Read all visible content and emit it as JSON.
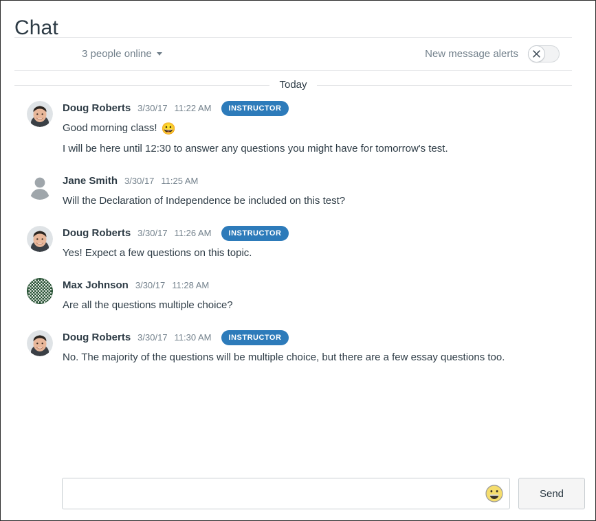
{
  "header": {
    "title": "Chat"
  },
  "toolbar": {
    "people_online_label": "3 people online",
    "alerts_label": "New message alerts",
    "alerts_toggle_state": "off",
    "alerts_toggle_icon": "close-x-icon"
  },
  "day_divider": {
    "label": "Today"
  },
  "messages": [
    {
      "author": "Doug Roberts",
      "date": "3/30/17",
      "time": "11:22 AM",
      "badge": "INSTRUCTOR",
      "avatar_type": "photo-man",
      "lines": [
        "Good morning class!",
        "I will be here until 12:30 to answer any questions you might have for tomorrow's test."
      ],
      "emoji": "😀"
    },
    {
      "author": "Jane Smith",
      "date": "3/30/17",
      "time": "11:25 AM",
      "badge": "",
      "avatar_type": "default-silhouette",
      "lines": [
        "Will the Declaration of Independence be included on this test?"
      ],
      "emoji": ""
    },
    {
      "author": "Doug Roberts",
      "date": "3/30/17",
      "time": "11:26 AM",
      "badge": "INSTRUCTOR",
      "avatar_type": "photo-man",
      "lines": [
        "Yes! Expect a few questions on this topic."
      ],
      "emoji": ""
    },
    {
      "author": "Max Johnson",
      "date": "3/30/17",
      "time": "11:28 AM",
      "badge": "",
      "avatar_type": "identicon-green",
      "lines": [
        "Are all the questions multiple choice?"
      ],
      "emoji": ""
    },
    {
      "author": "Doug Roberts",
      "date": "3/30/17",
      "time": "11:30 AM",
      "badge": "INSTRUCTOR",
      "avatar_type": "photo-man",
      "lines": [
        "No. The majority of the questions will be multiple choice, but there are a few essay questions too."
      ],
      "emoji": ""
    }
  ],
  "composer": {
    "message_value": "",
    "message_placeholder": "",
    "emoji_icon": "smiley-face-icon",
    "send_label": "Send"
  },
  "colors": {
    "badge_blue": "#2d7bba",
    "text_primary": "#2d3b45",
    "text_muted": "#73818c",
    "border": "#e4e6e8",
    "identicon_green": "#1d4a2b"
  }
}
